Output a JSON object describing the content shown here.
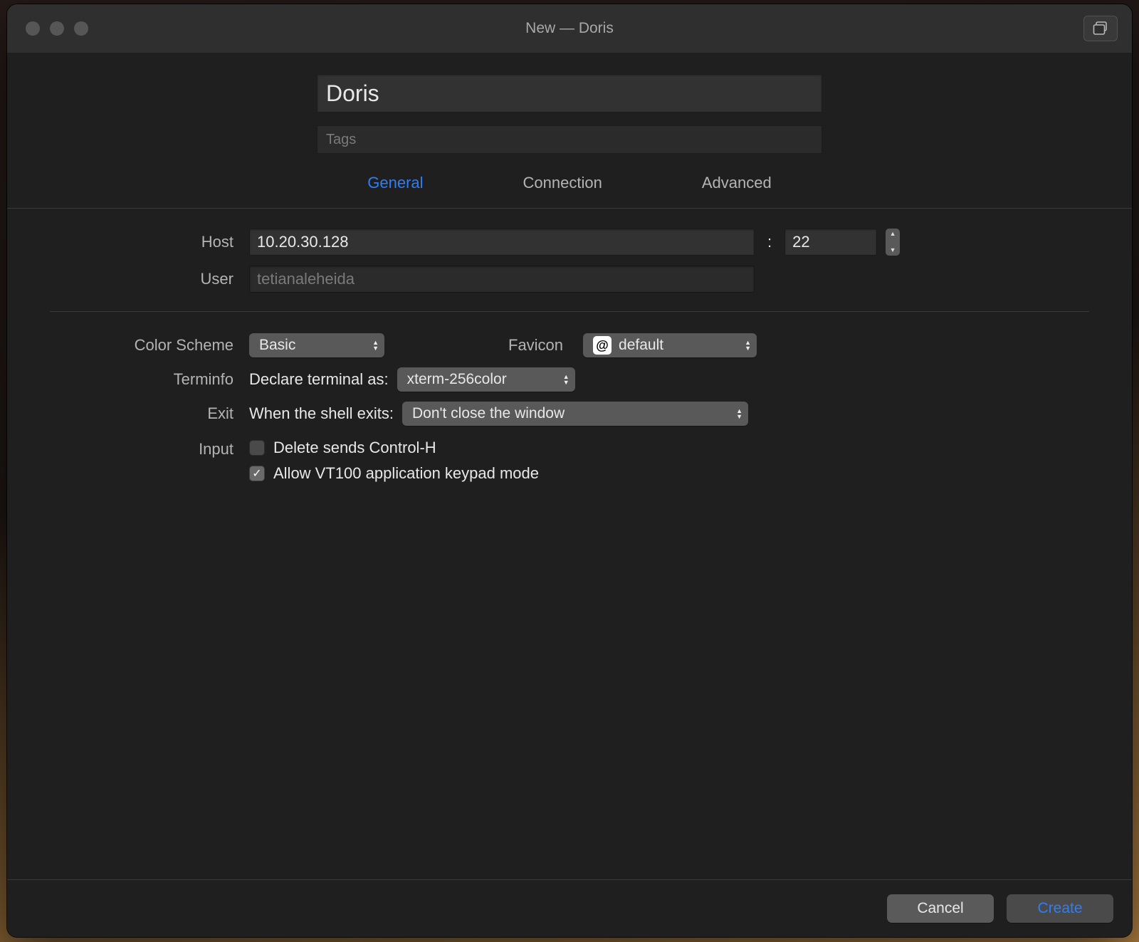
{
  "window": {
    "title": "New — Doris"
  },
  "header": {
    "name_value": "Doris",
    "tags_placeholder": "Tags"
  },
  "tabs": {
    "general": "General",
    "connection": "Connection",
    "advanced": "Advanced",
    "active": "general"
  },
  "connection": {
    "host_label": "Host",
    "host_value": "10.20.30.128",
    "port_separator": ":",
    "port_value": "22",
    "user_label": "User",
    "user_value": "tetianaleheida"
  },
  "settings": {
    "color_scheme": {
      "label": "Color Scheme",
      "value": "Basic"
    },
    "favicon": {
      "label": "Favicon",
      "glyph": "@",
      "value": "default"
    },
    "terminfo": {
      "label": "Terminfo",
      "prefix": "Declare terminal as:",
      "value": "xterm-256color"
    },
    "exit": {
      "label": "Exit",
      "prefix": "When the shell exits:",
      "value": "Don't close the window"
    },
    "input": {
      "label": "Input",
      "delete_ctrl_h": {
        "checked": false,
        "label": "Delete sends Control-H"
      },
      "vt100_keypad": {
        "checked": true,
        "label": "Allow VT100 application keypad mode"
      }
    }
  },
  "footer": {
    "cancel": "Cancel",
    "create": "Create"
  }
}
